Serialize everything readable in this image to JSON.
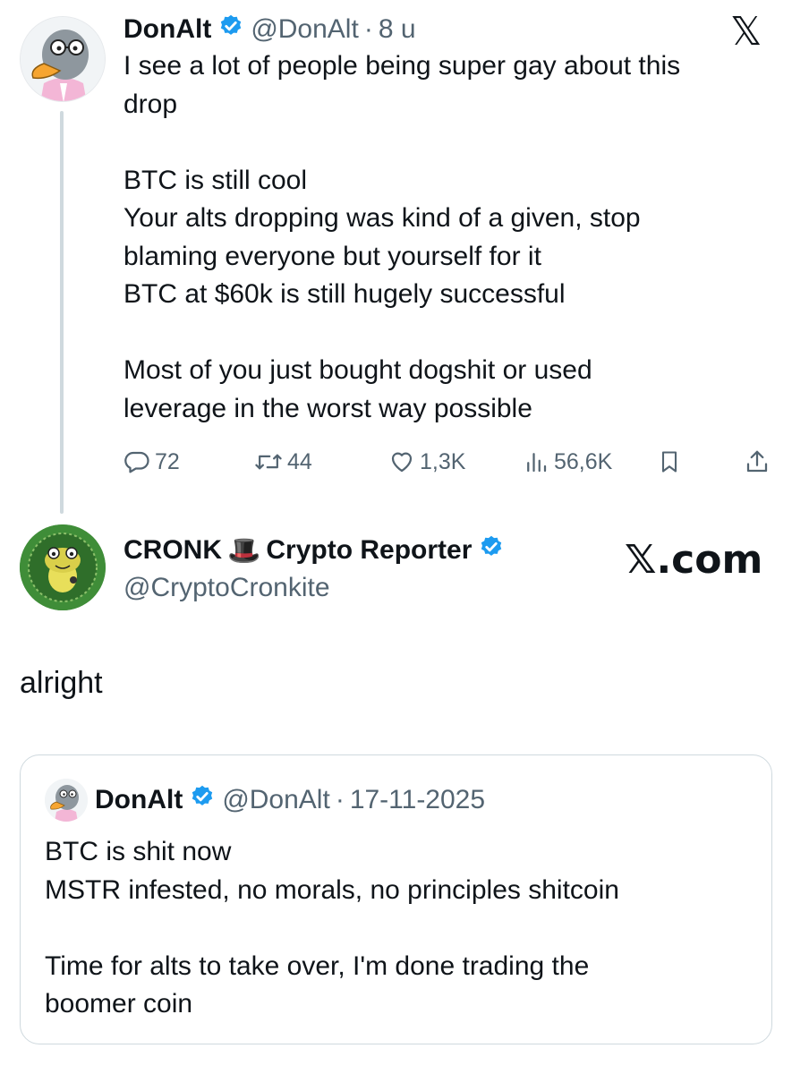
{
  "tweet": {
    "author": {
      "display_name": "DonAlt",
      "handle": "@DonAlt",
      "separator": "·",
      "time": "8 u"
    },
    "text_lines": [
      "I see a lot of people being super gay about this",
      "drop",
      "",
      "BTC is still cool",
      "Your alts dropping was kind of a given, stop",
      "blaming everyone but yourself for it",
      "BTC at $60k is still hugely successful",
      "",
      "Most of you just bought dogshit or used",
      "leverage in the worst way possible"
    ],
    "actions": {
      "replies": "72",
      "reposts": "44",
      "likes": "1,3K",
      "views": "56,6K"
    },
    "x_logo": "𝕏"
  },
  "reply": {
    "author": {
      "display_name_prefix": "CRONK",
      "emoji": "🎩",
      "display_name_suffix": "Crypto Reporter",
      "handle": "@CryptoCronkite"
    },
    "watermark": "𝕏.com",
    "text": "alright"
  },
  "quoted_tweet": {
    "author": {
      "display_name": "DonAlt",
      "handle": "@DonAlt",
      "separator": "·",
      "date": "17-11-2025"
    },
    "text_lines": [
      "BTC is shit now",
      "MSTR infested, no morals, no principles shitcoin",
      "",
      "Time for alts to take over, I'm done trading the",
      "boomer coin"
    ]
  },
  "colors": {
    "verified_blue": "#1d9bf0",
    "text_primary": "#0f1419",
    "text_secondary": "#536471",
    "border": "#cfd9de"
  },
  "icons": [
    "reply-icon",
    "repost-icon",
    "like-icon",
    "views-icon",
    "bookmark-icon",
    "share-icon",
    "verified-badge-icon",
    "x-logo-icon"
  ]
}
